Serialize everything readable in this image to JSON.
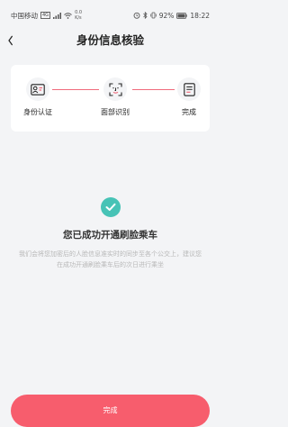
{
  "status_bar": {
    "carrier": "中国移动",
    "network": "4G",
    "speed_value": "0.0",
    "speed_unit": "K/s",
    "battery": "92%",
    "time": "18:22"
  },
  "navbar": {
    "title": "身份信息核验"
  },
  "steps": [
    {
      "label": "身份认证"
    },
    {
      "label": "面部识别"
    },
    {
      "label": "完成"
    }
  ],
  "result": {
    "title": "您已成功开通刷脸乘车",
    "description": "我们会将您加密后的人脸信息准实时的同步至各个公交上，建议您在成功开通刷脸乘车后的次日进行乘坐"
  },
  "done_button": {
    "label": "完成"
  },
  "colors": {
    "accent": "#f06b7c",
    "button": "#f75d6d",
    "success": "#47c3b6"
  }
}
